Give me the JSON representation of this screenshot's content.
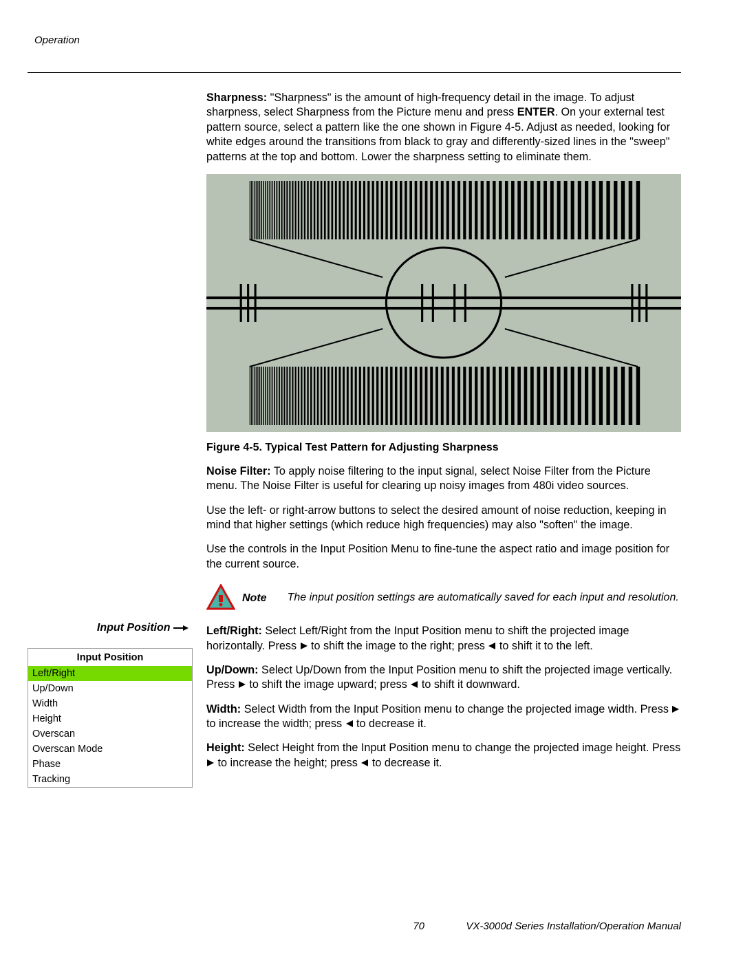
{
  "header": {
    "section": "Operation"
  },
  "body": {
    "sharpness": {
      "label": "Sharpness:",
      "text_a": " \"Sharpness\" is the amount of high-frequency detail in the image. To adjust sharpness, select Sharpness from the Picture menu and press ",
      "enter": "ENTER",
      "text_b": ". On your external test pattern source, select a pattern like the one shown in Figure 4-5. Adjust as needed, looking for white edges around the transitions from black to gray and differently-sized lines in the \"sweep\" patterns at the top and bottom. Lower the sharpness setting to eliminate them."
    },
    "figure_caption": "Figure 4-5. Typical Test Pattern for Adjusting Sharpness",
    "noise_filter": {
      "label": "Noise Filter:",
      "text": " To apply noise filtering to the input signal, select Noise Filter from the Picture menu. The Noise Filter is useful for clearing up noisy images from 480i video sources."
    },
    "noise_filter_p2": "Use the left- or right-arrow buttons to select the desired amount of noise reduction, keeping in mind that higher settings (which reduce high frequencies) may also \"soften\" the image.",
    "input_position_intro": "Use the controls in the Input Position Menu to fine-tune the aspect ratio and image position for the current source.",
    "note": {
      "label": "Note",
      "text": "The input position settings are automatically saved for each input and resolution."
    },
    "left_right": {
      "label": "Left/Right:",
      "a": " Select Left/Right from the Input Position menu to shift the projected image horizontally. Press ",
      "b": " to shift the image to the right; press ",
      "c": " to shift it to the left."
    },
    "up_down": {
      "label": "Up/Down:",
      "a": " Select Up/Down from the Input Position menu to shift the projected image vertically. Press ",
      "b": " to shift the image upward; press ",
      "c": " to shift it downward."
    },
    "width": {
      "label": "Width:",
      "a": " Select Width from the Input Position menu to change the projected image width. Press ",
      "b": " to increase the width; press ",
      "c": " to decrease it."
    },
    "height": {
      "label": "Height:",
      "a": " Select Height from the Input Position menu to change the projected image height. Press ",
      "b": " to increase the height; press ",
      "c": " to decrease it."
    }
  },
  "sidebar": {
    "heading": "Input Position",
    "menu_title": "Input Position",
    "items": [
      {
        "label": "Left/Right",
        "selected": true
      },
      {
        "label": "Up/Down",
        "selected": false
      },
      {
        "label": "Width",
        "selected": false
      },
      {
        "label": "Height",
        "selected": false
      },
      {
        "label": "Overscan",
        "selected": false
      },
      {
        "label": "Overscan Mode",
        "selected": false
      },
      {
        "label": "Phase",
        "selected": false
      },
      {
        "label": "Tracking",
        "selected": false
      }
    ]
  },
  "footer": {
    "page": "70",
    "title": "VX-3000d Series Installation/Operation Manual"
  }
}
